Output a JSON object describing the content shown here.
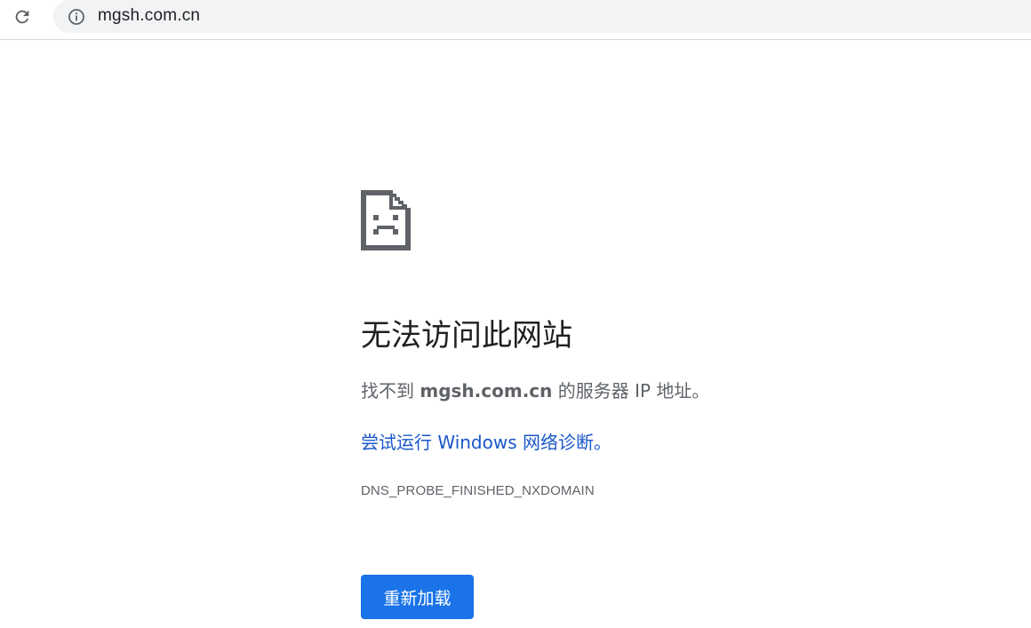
{
  "browser": {
    "url": "mgsh.com.cn",
    "icons": {
      "reload": "reload-icon",
      "site_info": "info-icon"
    }
  },
  "error_page": {
    "icon": "sad-page-icon",
    "heading": "无法访问此网站",
    "description_prefix": "找不到 ",
    "description_domain": "mgsh.com.cn",
    "description_suffix": " 的服务器 IP 地址。",
    "diagnostics_link": "尝试运行 Windows 网络诊断。",
    "error_code": "DNS_PROBE_FINISHED_NXDOMAIN",
    "reload_button": "重新加载"
  },
  "colors": {
    "heading": "#202124",
    "body_text": "#5f6368",
    "link": "#1a57c9",
    "button_bg": "#1a73e8",
    "button_text": "#ffffff",
    "omnibox_bg": "#f1f3f4"
  }
}
